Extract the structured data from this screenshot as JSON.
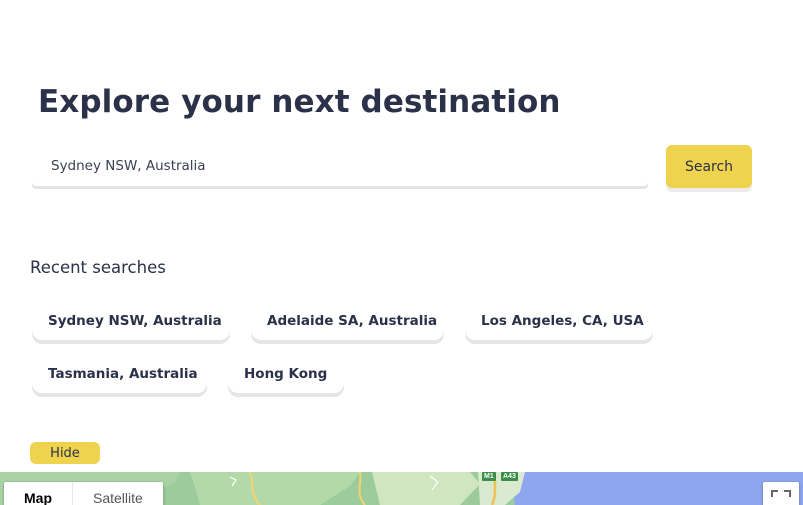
{
  "header": {
    "title": "Explore your next destination"
  },
  "search": {
    "value": "Sydney NSW, Australia",
    "button_label": "Search"
  },
  "recent": {
    "heading": "Recent searches",
    "items": [
      "Sydney NSW, Australia",
      "Adelaide SA, Australia",
      "Los Angeles, CA, USA",
      "Tasmania, Australia",
      "Hong Kong"
    ]
  },
  "toggle": {
    "hide_label": "Hide"
  },
  "map": {
    "type_options": [
      "Map",
      "Satellite"
    ],
    "selected_type": "Map",
    "route_badges": [
      "M1",
      "A43"
    ]
  },
  "colors": {
    "accent": "#efd24d",
    "text": "#2b3148",
    "map_land": "#9ccb9c",
    "map_water": "#8ea6ef"
  }
}
